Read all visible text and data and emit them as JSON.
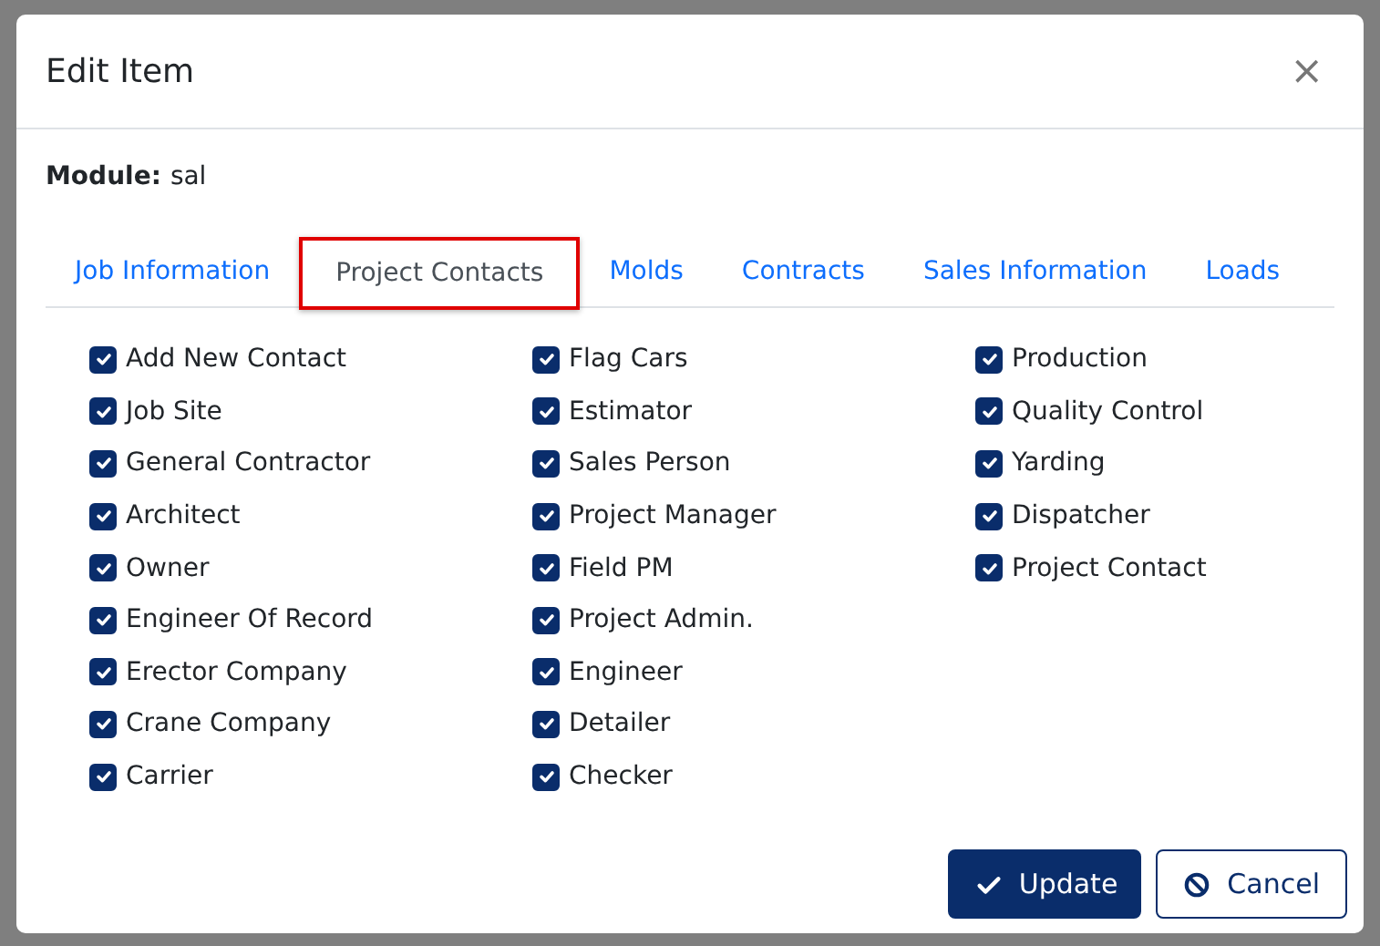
{
  "dialog": {
    "title": "Edit Item",
    "close": "×"
  },
  "module": {
    "label": "Module:",
    "value": "sal"
  },
  "tabs": [
    {
      "label": "Job Information",
      "selected": false
    },
    {
      "label": "Project Contacts",
      "selected": true
    },
    {
      "label": "Molds",
      "selected": false
    },
    {
      "label": "Contracts",
      "selected": false
    },
    {
      "label": "Sales Information",
      "selected": false
    },
    {
      "label": "Loads",
      "selected": false
    }
  ],
  "columns": [
    [
      {
        "label": "Add New Contact",
        "checked": true
      },
      {
        "label": "Job Site",
        "checked": true
      },
      {
        "label": "General Contractor",
        "checked": true
      },
      {
        "label": "Architect",
        "checked": true
      },
      {
        "label": "Owner",
        "checked": true
      },
      {
        "label": "Engineer Of Record",
        "checked": true
      },
      {
        "label": "Erector Company",
        "checked": true
      },
      {
        "label": "Crane Company",
        "checked": true
      },
      {
        "label": "Carrier",
        "checked": true
      }
    ],
    [
      {
        "label": "Flag Cars",
        "checked": true
      },
      {
        "label": "Estimator",
        "checked": true
      },
      {
        "label": "Sales Person",
        "checked": true
      },
      {
        "label": "Project Manager",
        "checked": true
      },
      {
        "label": "Field PM",
        "checked": true
      },
      {
        "label": "Project Admin.",
        "checked": true
      },
      {
        "label": "Engineer",
        "checked": true
      },
      {
        "label": "Detailer",
        "checked": true
      },
      {
        "label": "Checker",
        "checked": true
      }
    ],
    [
      {
        "label": "Production",
        "checked": true
      },
      {
        "label": "Quality Control",
        "checked": true
      },
      {
        "label": "Yarding",
        "checked": true
      },
      {
        "label": "Dispatcher",
        "checked": true
      },
      {
        "label": "Project Contact",
        "checked": true
      }
    ]
  ],
  "buttons": [
    {
      "label": "Update",
      "kind": "primary"
    },
    {
      "label": "Cancel",
      "kind": "secondary"
    }
  ]
}
